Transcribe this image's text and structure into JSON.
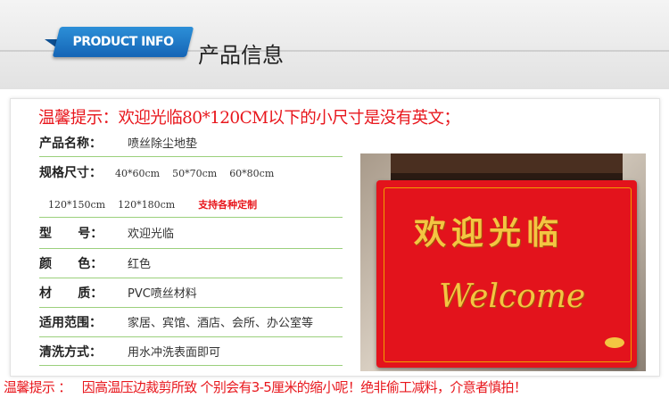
{
  "header": {
    "ribbon_text": "PRODUCT INFO",
    "title": "产品信息"
  },
  "notice_top": "温馨提示：欢迎光临80*120CM以下的小尺寸是没有英文；",
  "specs": {
    "name": {
      "label": "产品名称：",
      "value": "喷丝除尘地垫"
    },
    "size": {
      "label": "规格尺寸：",
      "values": [
        "40*60cm",
        "50*70cm",
        "60*80cm",
        "120*150cm",
        "120*180cm"
      ],
      "custom": "支持各种定制"
    },
    "model": {
      "label": "型      号：",
      "value": "欢迎光临"
    },
    "color": {
      "label": "颜      色：",
      "value": "红色"
    },
    "material": {
      "label": "材      质：",
      "value": "PVC喷丝材料"
    },
    "usage": {
      "label": "适用范围：",
      "value": "家居、宾馆、酒店、会所、办公室等"
    },
    "cleaning": {
      "label": "清洗方式：",
      "value": "用水冲洗表面即可"
    }
  },
  "mat_photo": {
    "chinese_text": "欢迎光临",
    "english_text": "Welcome"
  },
  "notice_bottom": "温馨提示 ：   因高温压边裁剪所致 个别会有3-5厘米的缩小呢！绝非偷工减料，介意者慎拍！",
  "colors": {
    "accent_red": "#e8171d",
    "ribbon_blue": "#1a73c4",
    "divider_green": "#9bd07c"
  }
}
